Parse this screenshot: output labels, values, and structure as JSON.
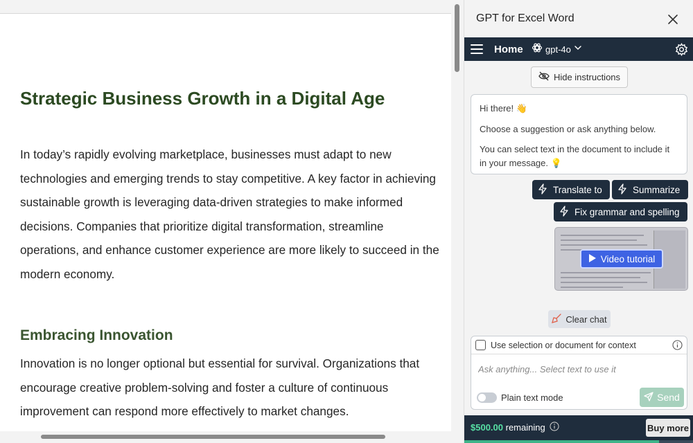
{
  "document": {
    "title": "Strategic Business Growth in a Digital Age",
    "paragraph1": "In today’s rapidly evolving marketplace, businesses must adapt to new technologies and emerging trends to stay competitive. A key factor in achieving sustainable growth is leveraging data-driven strategies to make informed decisions. Companies that prioritize digital transformation, streamline operations, and enhance customer experience are more likely to succeed in the modern economy.",
    "heading2": "Embracing Innovation",
    "paragraph2": "Innovation is no longer optional but essential for survival. Organizations that encourage creative problem-solving and foster a culture of continuous improvement can respond more effectively to market changes."
  },
  "panel": {
    "title": "GPT for Excel Word",
    "nav": {
      "home_label": "Home",
      "model_label": "gpt-4o"
    },
    "hide_instructions_label": "Hide instructions",
    "message": {
      "greeting": "Hi there! 👋",
      "line1": "Choose a suggestion or ask anything below.",
      "line2": "You can select text in the document to include it in your message. 💡"
    },
    "suggestions": {
      "translate": "Translate to",
      "summarize": "Summarize",
      "fix_grammar": "Fix grammar and spelling"
    },
    "video_tutorial_label": "Video tutorial",
    "clear_chat_label": "Clear chat",
    "composer": {
      "context_label": "Use selection or document for context",
      "context_checked": false,
      "input_placeholder": "Ask anything... Select text to use it",
      "input_value": "",
      "plain_text_label": "Plain text mode",
      "plain_text_on": false,
      "send_label": "Send"
    },
    "footer": {
      "credit_amount": "$500.00",
      "credit_text": "remaining",
      "buy_more_label": "Buy more",
      "credit_level": 0.85
    }
  },
  "colors": {
    "panel_dark": "#1f2d3d",
    "accent_green": "#57e0a4",
    "title_green": "#2c4a22",
    "video_blue": "#3e63e3"
  }
}
